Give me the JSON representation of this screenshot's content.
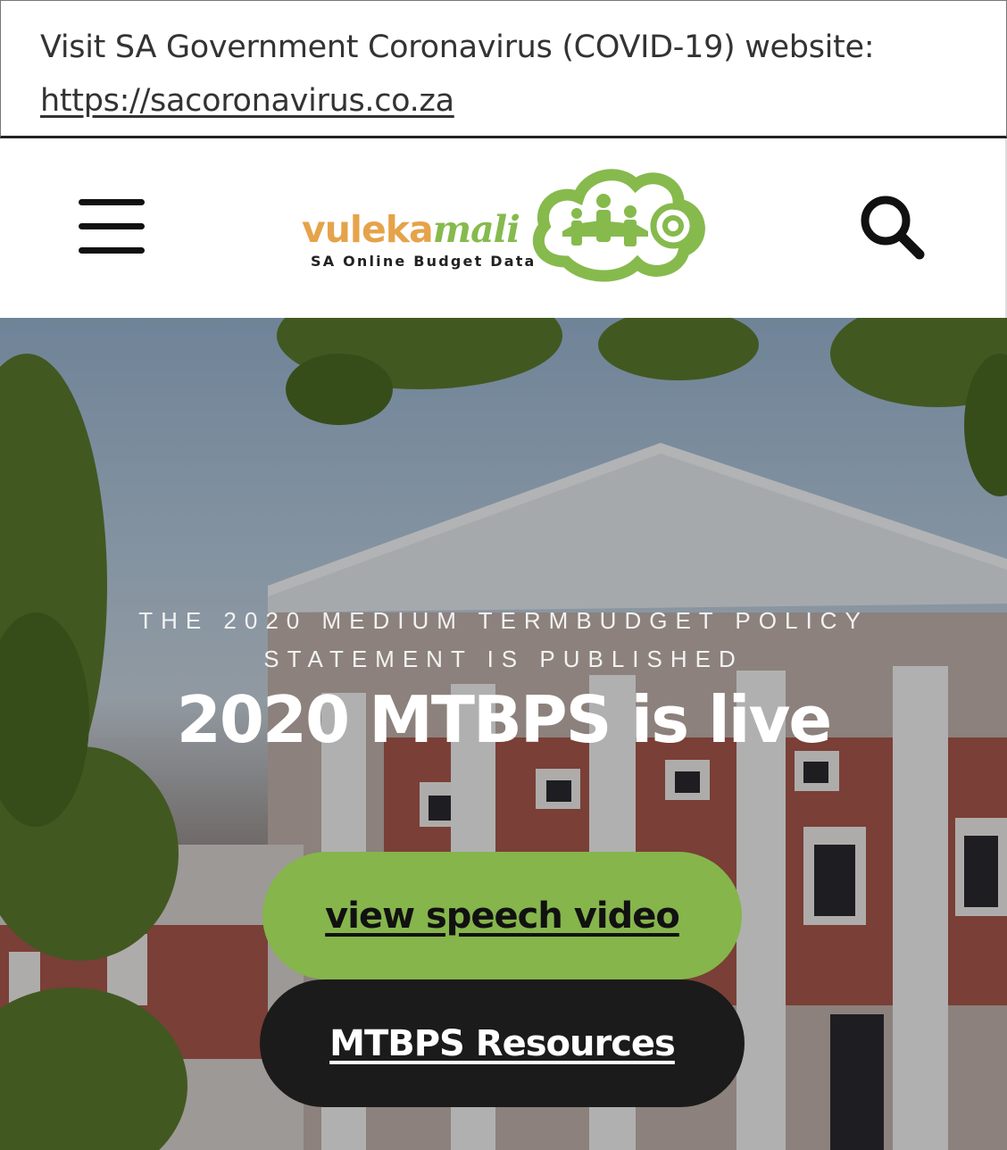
{
  "covid_banner": {
    "text": "Visit SA Government Coronavirus (COVID-19) website:",
    "link": "https://sacoronavirus.co.za"
  },
  "header": {
    "menu_icon": "hamburger-menu-icon",
    "search_icon": "search-icon",
    "logo": {
      "word_part1": "vuleka",
      "word_part2": "mali",
      "tagline": "SA Online Budget Data"
    }
  },
  "hero": {
    "eyebrow_line1": "THE 2020 MEDIUM TERMBUDGET POLICY",
    "eyebrow_line2": "STATEMENT IS PUBLISHED",
    "title": "2020 MTBPS is live",
    "primary_button": "view speech video",
    "secondary_button": "MTBPS Resources"
  },
  "colors": {
    "brand_green": "#86b54c",
    "brand_orange": "#e5a34a",
    "dark_button": "#1b1b1b"
  }
}
